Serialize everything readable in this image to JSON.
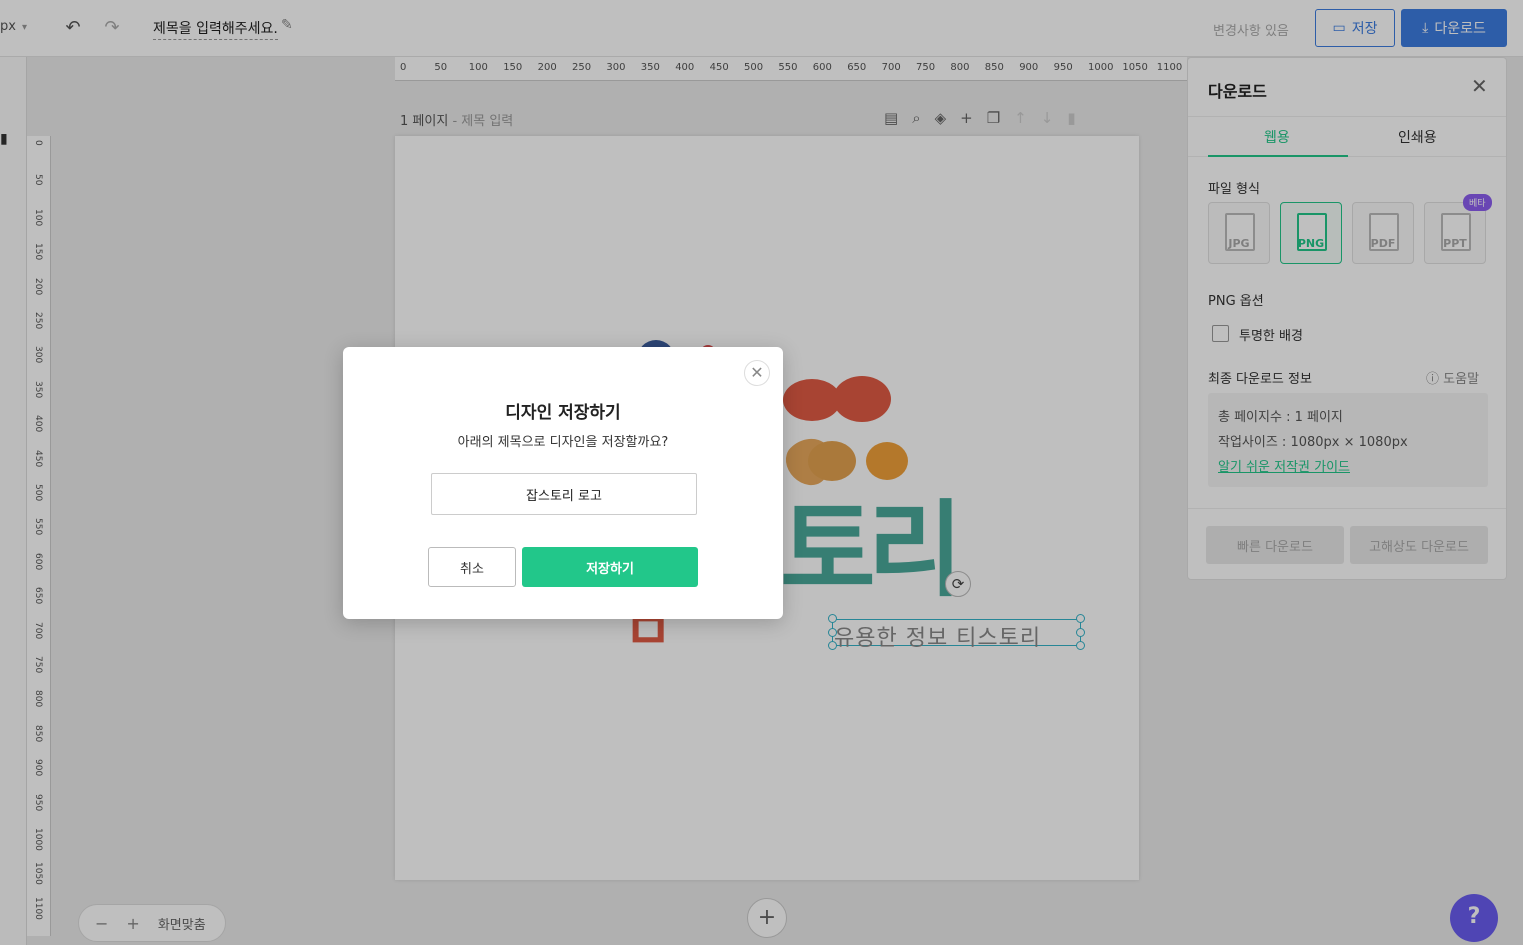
{
  "topbar": {
    "unit": "px",
    "doc_title": "제목을 입력해주세요.",
    "changes_status": "변경사항 있음",
    "save_label": "저장",
    "download_label": "다운로드"
  },
  "ruler": {
    "top_ticks": [
      "0",
      "50",
      "100",
      "150",
      "200",
      "250",
      "300",
      "350",
      "400",
      "450",
      "500",
      "550",
      "600",
      "650",
      "700",
      "750",
      "800",
      "850",
      "900",
      "950",
      "1000",
      "1050",
      "1100"
    ],
    "left_ticks": [
      "0",
      "50",
      "100",
      "150",
      "200",
      "250",
      "300",
      "350",
      "400",
      "450",
      "500",
      "550",
      "600",
      "650",
      "700",
      "750",
      "800",
      "850",
      "900",
      "950",
      "1000",
      "1050",
      "1100"
    ]
  },
  "page": {
    "label": "1 페이지",
    "sub_label": "- 제목 입력"
  },
  "canvas": {
    "logo_text": "토리",
    "logo_small_char": "ㅁ",
    "selected_text": "유용한 정보 티스토리"
  },
  "zoom": {
    "fit_label": "화면맞춤"
  },
  "panel": {
    "title": "다운로드",
    "tabs": [
      "웹용",
      "인쇄용"
    ],
    "file_format_label": "파일 형식",
    "formats": [
      "JPG",
      "PNG",
      "PDF",
      "PPT"
    ],
    "beta_badge": "베타",
    "png_options_label": "PNG 옵션",
    "transparent_bg_label": "투명한 배경",
    "final_info_label": "최종 다운로드 정보",
    "help_label": "도움말",
    "total_pages": "총 페이지수 : 1 페이지",
    "work_size": "작업사이즈 : 1080px × 1080px",
    "guide_link": "알기 쉬운 저작권 가이드",
    "quick_download": "빠른 다운로드",
    "hires_download": "고해상도 다운로드"
  },
  "modal": {
    "title": "디자인 저장하기",
    "subtitle": "아래의 제목으로 디자인을 저장할까요?",
    "input_value": "잡스토리 로고",
    "cancel_label": "취소",
    "confirm_label": "저장하기"
  },
  "colors": {
    "accent_green": "#22c78a",
    "accent_blue": "#3d7de0",
    "beta_purple": "#8c5ef0",
    "logo_red": "#e15b45",
    "logo_orange": "#f0a13a",
    "logo_teal": "#4aa89a",
    "logo_blue": "#5aaad8"
  }
}
